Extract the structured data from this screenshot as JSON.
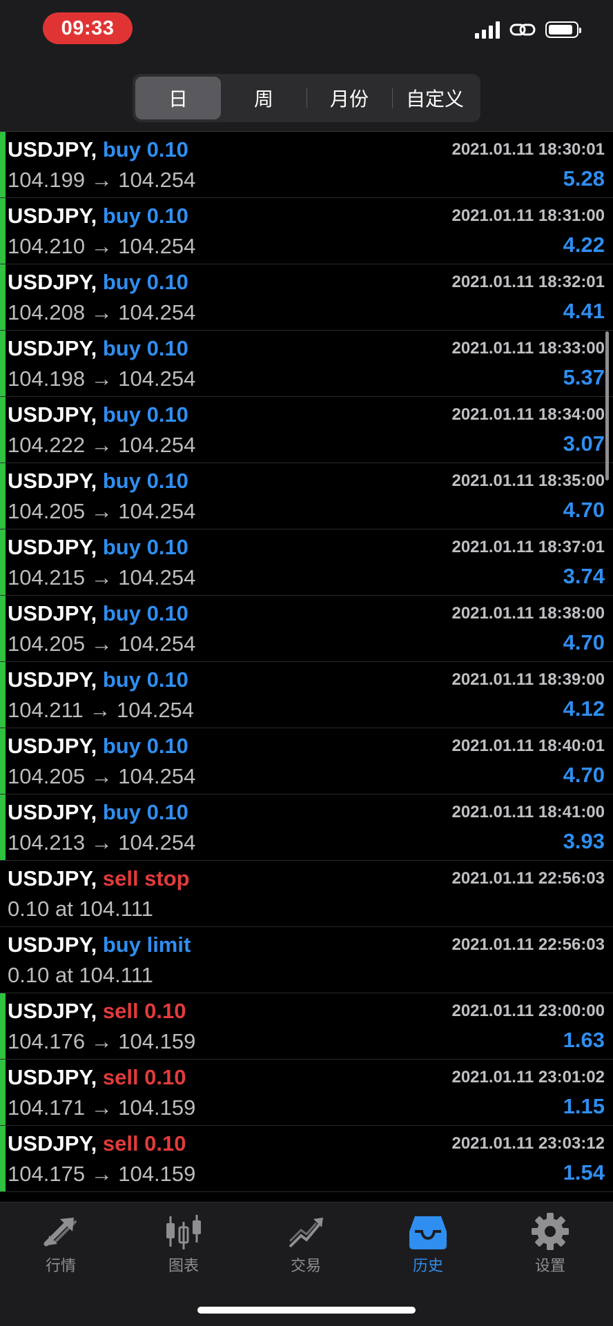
{
  "status_bar": {
    "time": "09:33"
  },
  "segments": [
    {
      "label": "日",
      "active": true
    },
    {
      "label": "周",
      "active": false
    },
    {
      "label": "月份",
      "active": false
    },
    {
      "label": "自定义",
      "active": false
    }
  ],
  "rows": [
    {
      "symbol": "USDJPY,",
      "action": "buy 0.10",
      "action_color": "blue",
      "detail": "104.199 → 104.254",
      "time": "2021.01.11 18:30:01",
      "profit": "5.28",
      "bar": true
    },
    {
      "symbol": "USDJPY,",
      "action": "buy 0.10",
      "action_color": "blue",
      "detail": "104.210 → 104.254",
      "time": "2021.01.11 18:31:00",
      "profit": "4.22",
      "bar": true
    },
    {
      "symbol": "USDJPY,",
      "action": "buy 0.10",
      "action_color": "blue",
      "detail": "104.208 → 104.254",
      "time": "2021.01.11 18:32:01",
      "profit": "4.41",
      "bar": true
    },
    {
      "symbol": "USDJPY,",
      "action": "buy 0.10",
      "action_color": "blue",
      "detail": "104.198 → 104.254",
      "time": "2021.01.11 18:33:00",
      "profit": "5.37",
      "bar": true
    },
    {
      "symbol": "USDJPY,",
      "action": "buy 0.10",
      "action_color": "blue",
      "detail": "104.222 → 104.254",
      "time": "2021.01.11 18:34:00",
      "profit": "3.07",
      "bar": true
    },
    {
      "symbol": "USDJPY,",
      "action": "buy 0.10",
      "action_color": "blue",
      "detail": "104.205 → 104.254",
      "time": "2021.01.11 18:35:00",
      "profit": "4.70",
      "bar": true
    },
    {
      "symbol": "USDJPY,",
      "action": "buy 0.10",
      "action_color": "blue",
      "detail": "104.215 → 104.254",
      "time": "2021.01.11 18:37:01",
      "profit": "3.74",
      "bar": true
    },
    {
      "symbol": "USDJPY,",
      "action": "buy 0.10",
      "action_color": "blue",
      "detail": "104.205 → 104.254",
      "time": "2021.01.11 18:38:00",
      "profit": "4.70",
      "bar": true
    },
    {
      "symbol": "USDJPY,",
      "action": "buy 0.10",
      "action_color": "blue",
      "detail": "104.211 → 104.254",
      "time": "2021.01.11 18:39:00",
      "profit": "4.12",
      "bar": true
    },
    {
      "symbol": "USDJPY,",
      "action": "buy 0.10",
      "action_color": "blue",
      "detail": "104.205 → 104.254",
      "time": "2021.01.11 18:40:01",
      "profit": "4.70",
      "bar": true
    },
    {
      "symbol": "USDJPY,",
      "action": "buy 0.10",
      "action_color": "blue",
      "detail": "104.213 → 104.254",
      "time": "2021.01.11 18:41:00",
      "profit": "3.93",
      "bar": true
    },
    {
      "symbol": "USDJPY,",
      "action": "sell stop",
      "action_color": "red",
      "detail": "0.10 at 104.111",
      "time": "2021.01.11 22:56:03",
      "profit": "",
      "bar": false
    },
    {
      "symbol": "USDJPY,",
      "action": "buy limit",
      "action_color": "blue",
      "detail": "0.10 at 104.111",
      "time": "2021.01.11 22:56:03",
      "profit": "",
      "bar": false
    },
    {
      "symbol": "USDJPY,",
      "action": "sell 0.10",
      "action_color": "red",
      "detail": "104.176 → 104.159",
      "time": "2021.01.11 23:00:00",
      "profit": "1.63",
      "bar": true
    },
    {
      "symbol": "USDJPY,",
      "action": "sell 0.10",
      "action_color": "red",
      "detail": "104.171 → 104.159",
      "time": "2021.01.11 23:01:02",
      "profit": "1.15",
      "bar": true
    },
    {
      "symbol": "USDJPY,",
      "action": "sell 0.10",
      "action_color": "red",
      "detail": "104.175 → 104.159",
      "time": "2021.01.11 23:03:12",
      "profit": "1.54",
      "bar": true
    }
  ],
  "tabs": [
    {
      "label": "行情",
      "icon": "quotes-arrows-icon",
      "active": false
    },
    {
      "label": "图表",
      "icon": "chart-candles-icon",
      "active": false
    },
    {
      "label": "交易",
      "icon": "trade-trend-icon",
      "active": false
    },
    {
      "label": "历史",
      "icon": "history-inbox-icon",
      "active": true
    },
    {
      "label": "设置",
      "icon": "settings-gear-icon",
      "active": false
    }
  ],
  "colors": {
    "accent_blue": "#2f8ef0",
    "sell_red": "#e33b3b",
    "position_green": "#2fc13f",
    "status_red": "#e03434"
  }
}
